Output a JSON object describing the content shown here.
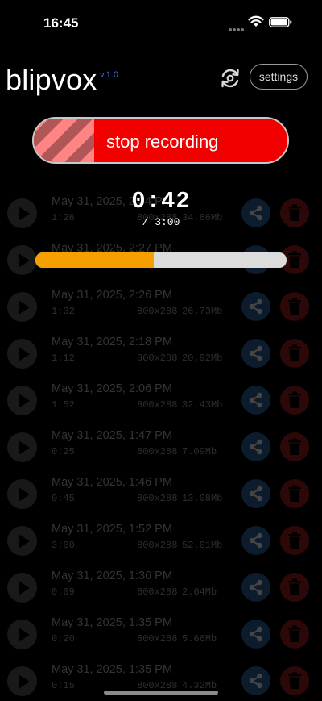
{
  "status_bar": {
    "time": "16:45"
  },
  "header": {
    "app_name": "blipvox",
    "version": "v.1.0",
    "settings_label": "settings"
  },
  "record_button": {
    "label": "stop recording"
  },
  "timer": {
    "elapsed": "0:42",
    "max": "/ 3:00",
    "progress": 0.47
  },
  "recordings": [
    {
      "date": "May 31, 2025, 2:34 PM",
      "duration": "1:26",
      "resolution": "800x288",
      "size": "34.86Mb"
    },
    {
      "date": "May 31, 2025, 2:27 PM",
      "duration": "",
      "resolution": "",
      "size": ""
    },
    {
      "date": "May 31, 2025, 2:26 PM",
      "duration": "1:32",
      "resolution": "800x288",
      "size": "26.73Mb"
    },
    {
      "date": "May 31, 2025, 2:18 PM",
      "duration": "1:12",
      "resolution": "800x288",
      "size": "20.92Mb"
    },
    {
      "date": "May 31, 2025, 2:06 PM",
      "duration": "1:52",
      "resolution": "800x288",
      "size": "32.43Mb"
    },
    {
      "date": "May 31, 2025, 1:47 PM",
      "duration": "0:25",
      "resolution": "800x288",
      "size": "7.09Mb"
    },
    {
      "date": "May 31, 2025, 1:46 PM",
      "duration": "0:45",
      "resolution": "800x288",
      "size": "13.08Mb"
    },
    {
      "date": "May 31, 2025, 1:52 PM",
      "duration": "3:00",
      "resolution": "800x288",
      "size": "52.01Mb"
    },
    {
      "date": "May 31, 2025, 1:36 PM",
      "duration": "0:09",
      "resolution": "800x288",
      "size": "2.64Mb"
    },
    {
      "date": "May 31, 2025, 1:35 PM",
      "duration": "0:20",
      "resolution": "800x288",
      "size": "5.66Mb"
    },
    {
      "date": "May 31, 2025, 1:35 PM",
      "duration": "0:15",
      "resolution": "800x288",
      "size": "4.32Mb"
    }
  ],
  "colors": {
    "record_red": "#f20000",
    "progress_orange": "#f5a000",
    "share_blue": "#2e6aa1",
    "trash_red": "#a32020",
    "version_blue": "#3a78e0"
  },
  "icons": {
    "play": "play-icon",
    "share": "share-icon",
    "trash": "trash-icon",
    "sync": "sync-icon"
  }
}
